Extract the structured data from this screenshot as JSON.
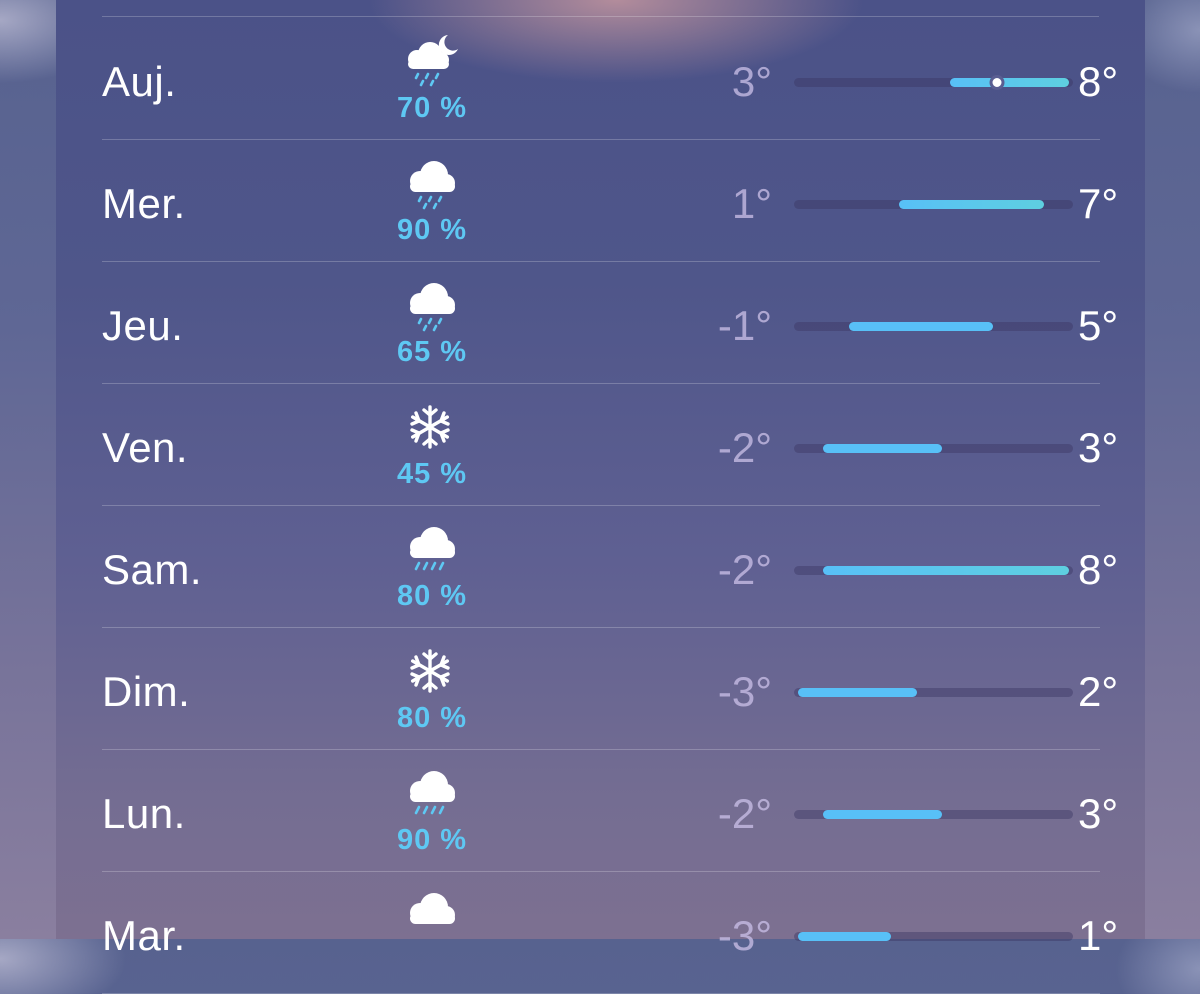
{
  "colors": {
    "precip": "#5ec8f3",
    "bar_cold": "#58c0f7",
    "bar_mild": "#5ecfe0",
    "track": "#3f3b68"
  },
  "forecast": {
    "range_min": -3,
    "range_max": 8,
    "days": [
      {
        "day": "Auj.",
        "icon": "cloud-moon-rain-icon",
        "precip": "70 %",
        "low_label": "3°",
        "high_label": "8°",
        "low": 3,
        "high": 8,
        "current": 5,
        "current_label": ""
      },
      {
        "day": "Mer.",
        "icon": "cloud-rain-icon",
        "precip": "90 %",
        "low_label": "1°",
        "high_label": "7°",
        "low": 1,
        "high": 7
      },
      {
        "day": "Jeu.",
        "icon": "cloud-rain-icon",
        "precip": "65 %",
        "low_label": "-1°",
        "high_label": "5°",
        "low": -1,
        "high": 5
      },
      {
        "day": "Ven.",
        "icon": "snowflake-icon",
        "precip": "45 %",
        "low_label": "-2°",
        "high_label": "3°",
        "low": -2,
        "high": 3
      },
      {
        "day": "Sam.",
        "icon": "cloud-heavy-rain-icon",
        "precip": "80 %",
        "low_label": "-2°",
        "high_label": "8°",
        "low": -2,
        "high": 8
      },
      {
        "day": "Dim.",
        "icon": "snowflake-icon",
        "precip": "80 %",
        "low_label": "-3°",
        "high_label": "2°",
        "low": -3,
        "high": 2
      },
      {
        "day": "Lun.",
        "icon": "cloud-heavy-rain-icon",
        "precip": "90 %",
        "low_label": "-2°",
        "high_label": "3°",
        "low": -2,
        "high": 3
      },
      {
        "day": "Mar.",
        "icon": "cloud-icon",
        "precip": "",
        "low_label": "-3°",
        "high_label": "1°",
        "low": -3,
        "high": 1
      }
    ]
  }
}
